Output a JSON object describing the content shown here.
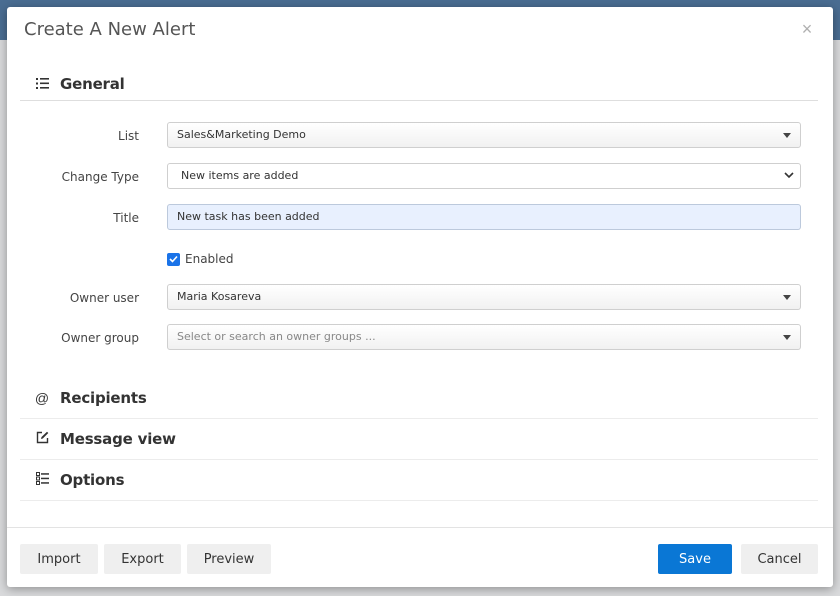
{
  "dialog": {
    "title": "Create A New Alert",
    "close_glyph": "×"
  },
  "sections": {
    "general": {
      "title": "General",
      "icon": "list-icon"
    },
    "recipients": {
      "title": "Recipients",
      "icon": "at-icon"
    },
    "message_view": {
      "title": "Message view",
      "icon": "edit-icon"
    },
    "options": {
      "title": "Options",
      "icon": "checklist-icon"
    }
  },
  "form": {
    "list": {
      "label": "List",
      "value": "Sales&Marketing Demo"
    },
    "change_type": {
      "label": "Change Type",
      "value": "New items are added"
    },
    "title": {
      "label": "Title",
      "value": "New task has been added"
    },
    "enabled": {
      "label": "Enabled",
      "checked": true
    },
    "owner_user": {
      "label": "Owner user",
      "value": "Maria Kosareva"
    },
    "owner_group": {
      "label": "Owner group",
      "placeholder": "Select or search an owner groups ..."
    }
  },
  "footer": {
    "import_label": "Import",
    "export_label": "Export",
    "preview_label": "Preview",
    "save_label": "Save",
    "cancel_label": "Cancel"
  },
  "colors": {
    "primary": "#0a77d5",
    "checkbox": "#1a73e8",
    "title_input_bg": "#e8f0fe"
  }
}
